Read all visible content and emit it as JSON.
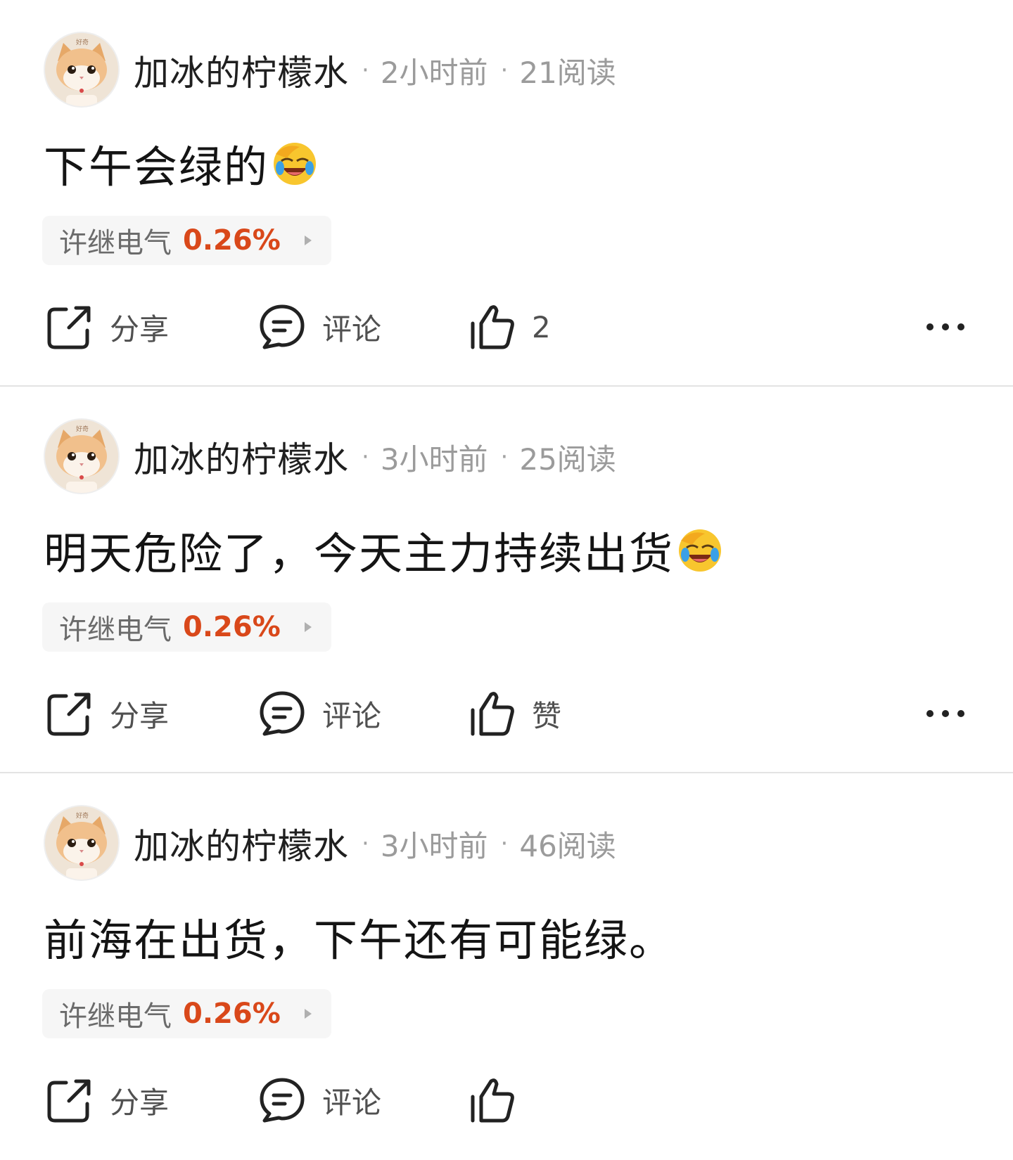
{
  "colors": {
    "accent_change": "#d9481a",
    "meta_gray": "#9b9b9b",
    "chip_background": "#f6f6f6",
    "divider": "#e3e3e3"
  },
  "posts": [
    {
      "username": "加冰的柠檬水",
      "time": "2小时前",
      "reads": "21阅读",
      "content": "下午会绿的",
      "content_emoji": "face-palm-crying-laughing-emoji",
      "stock": {
        "name": "许继电气",
        "change": "0.26%"
      },
      "actions": {
        "share_label": "分享",
        "comment_label": "评论",
        "like_label": "2"
      }
    },
    {
      "username": "加冰的柠檬水",
      "time": "3小时前",
      "reads": "25阅读",
      "content": "明天危险了，今天主力持续出货",
      "content_emoji": "face-palm-crying-laughing-emoji",
      "stock": {
        "name": "许继电气",
        "change": "0.26%"
      },
      "actions": {
        "share_label": "分享",
        "comment_label": "评论",
        "like_label": "赞"
      }
    },
    {
      "username": "加冰的柠檬水",
      "time": "3小时前",
      "reads": "46阅读",
      "content": "前海在出货，下午还有可能绿。",
      "content_emoji": "",
      "stock": {
        "name": "许继电气",
        "change": "0.26%"
      },
      "actions": {
        "share_label": "分享",
        "comment_label": "评论",
        "like_label": ""
      }
    }
  ],
  "avatar_caption": "好奇"
}
